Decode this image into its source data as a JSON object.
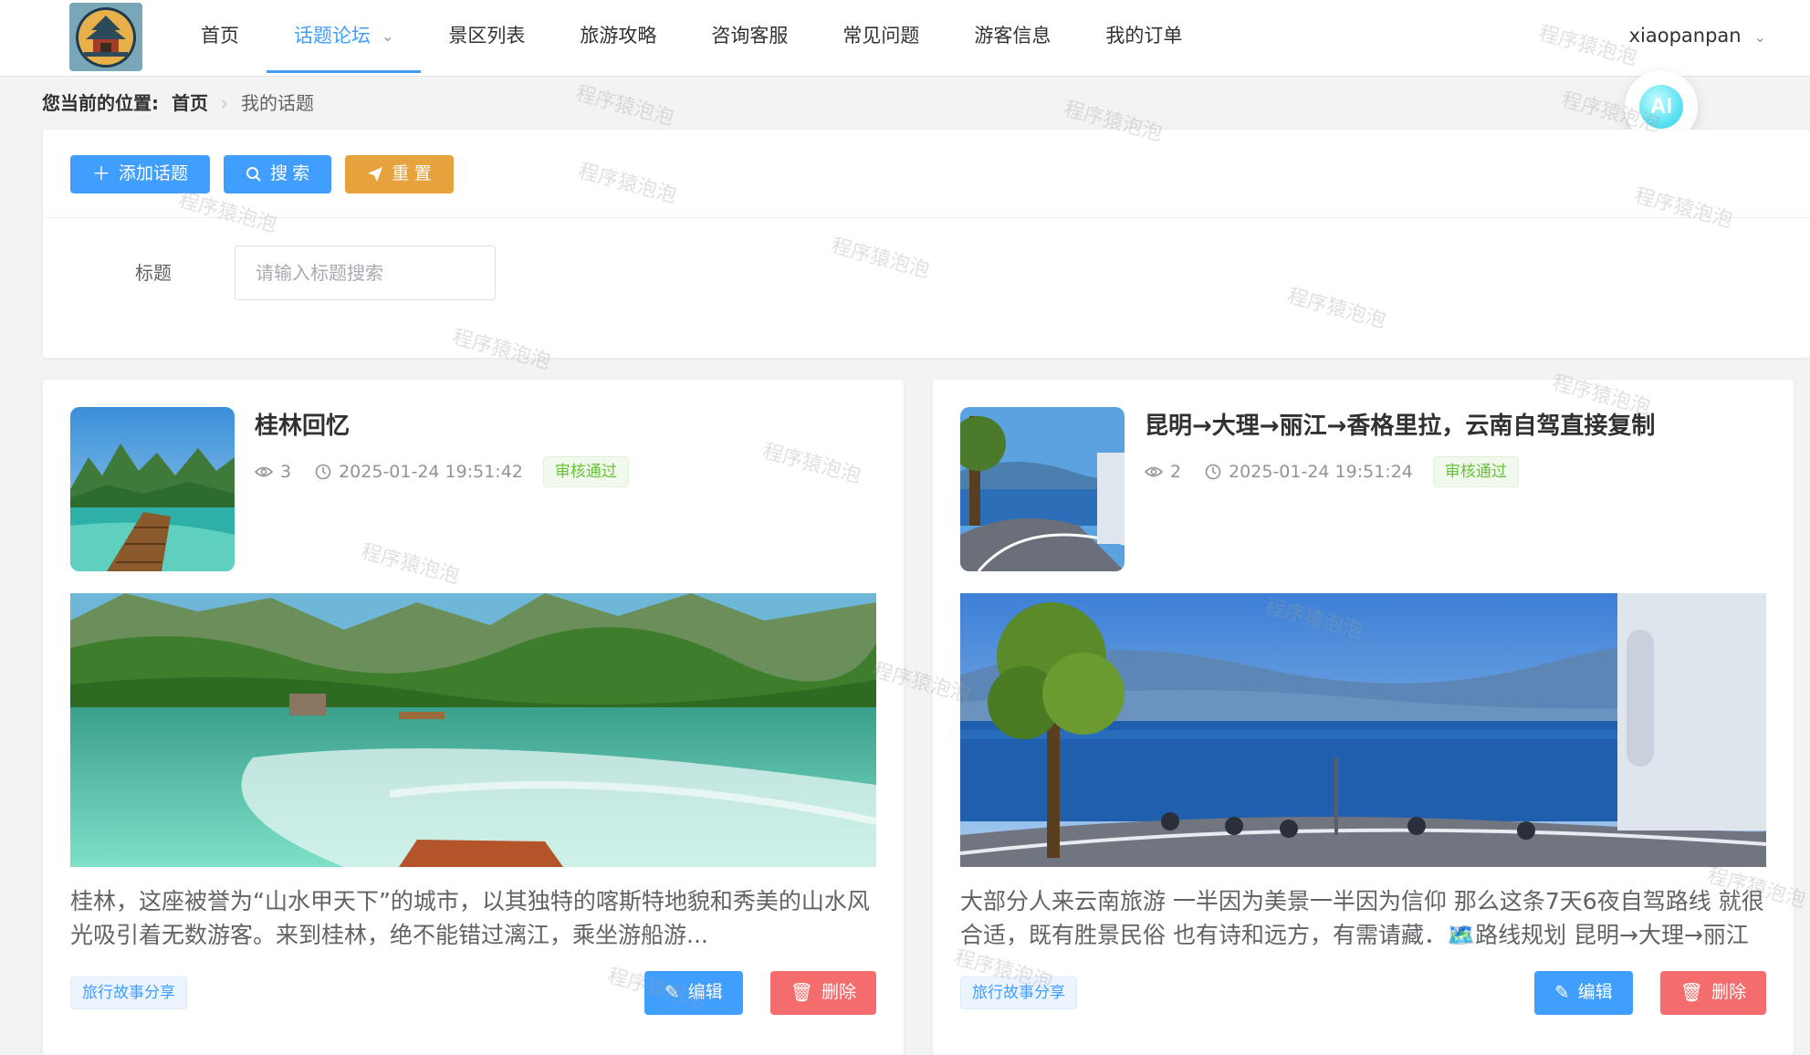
{
  "nav": {
    "items": [
      {
        "label": "首页"
      },
      {
        "label": "话题论坛",
        "active": true,
        "dropdown": true
      },
      {
        "label": "景区列表"
      },
      {
        "label": "旅游攻略"
      },
      {
        "label": "咨询客服"
      },
      {
        "label": "常见问题"
      },
      {
        "label": "游客信息"
      },
      {
        "label": "我的订单"
      }
    ],
    "username": "xiaopanpan"
  },
  "ai": {
    "label": "AI"
  },
  "breadcrumb": {
    "prefix": "您当前的位置:",
    "home": "首页",
    "current": "我的话题"
  },
  "toolbar": {
    "add_label": "添加话题",
    "search_label": "搜 索",
    "reset_label": "重 置"
  },
  "search": {
    "field_label": "标题",
    "placeholder": "请输入标题搜索"
  },
  "cards": [
    {
      "title": "桂林回忆",
      "views": "3",
      "time": "2025-01-24 19:51:42",
      "status": "审核通过",
      "excerpt": "桂林，这座被誉为“山水甲天下”的城市，以其独特的喀斯特地貌和秀美的山水风光吸引着无数游客。来到桂林，绝不能错过漓江，乘坐游船游...",
      "tag": "旅行故事分享",
      "edit_label": "编辑",
      "delete_label": "删除"
    },
    {
      "title": "昆明→大理→丽江→香格里拉，云南自驾直接复制",
      "views": "2",
      "time": "2025-01-24 19:51:24",
      "status": "审核通过",
      "excerpt": "大部分人来云南旅游 一半因为美景一半因为信仰 那么这条7天6夜自驾路线 就很合适，既有胜景民俗 也有诗和远方，有需请藏．🗺️路线规划 昆明→大理→丽江→香...",
      "tag": "旅行故事分享",
      "edit_label": "编辑",
      "delete_label": "删除"
    }
  ],
  "watermark": "程序猿泡泡",
  "colors": {
    "primary": "#409eff",
    "warning": "#e6a23c",
    "danger": "#f56c6c",
    "success": "#67c23a"
  }
}
